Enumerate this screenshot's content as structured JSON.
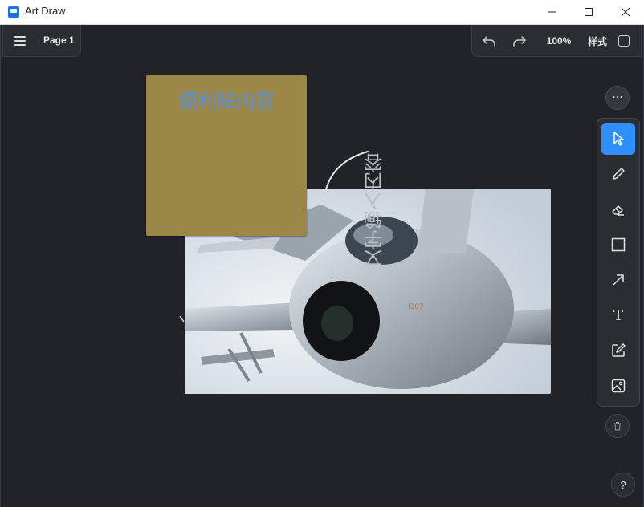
{
  "window": {
    "title": "Art Draw",
    "minimize_icon": "minimize-icon",
    "maximize_icon": "maximize-icon",
    "close_icon": "close-icon"
  },
  "header": {
    "menu_icon": "hamburger-menu-icon",
    "page_label": "Page 1",
    "undo_icon": "undo-icon",
    "redo_icon": "redo-icon",
    "zoom": "100%",
    "style_label": "样式",
    "style_icon": "style-square-icon"
  },
  "toolbar": {
    "more_icon": "more-horizontal-icon",
    "tools": [
      {
        "name": "select",
        "icon": "cursor-icon",
        "active": true
      },
      {
        "name": "pen",
        "icon": "pencil-icon",
        "active": false
      },
      {
        "name": "eraser",
        "icon": "eraser-icon",
        "active": false
      },
      {
        "name": "rectangle",
        "icon": "rectangle-icon",
        "active": false
      },
      {
        "name": "arrow",
        "icon": "arrow-icon",
        "active": false
      },
      {
        "name": "text",
        "icon": "text-icon",
        "active": false
      },
      {
        "name": "note",
        "icon": "note-edit-icon",
        "active": false
      },
      {
        "name": "image",
        "icon": "image-icon",
        "active": false
      }
    ],
    "text_tool_label": "T",
    "delete_icon": "trash-icon",
    "help_label": "?"
  },
  "canvas": {
    "sticky_note_text": "便利贴内容",
    "vertical_text": "文字输入内容",
    "image_subject": "fighter-jet-image"
  },
  "colors": {
    "background": "#212329",
    "accent": "#2f8fff",
    "sticky": "#9b8848",
    "sticky_text": "#5b8fd8"
  }
}
